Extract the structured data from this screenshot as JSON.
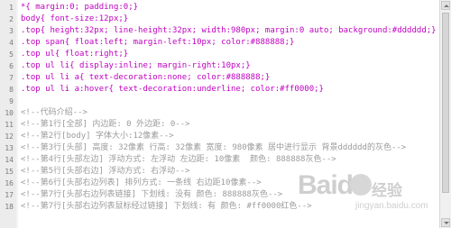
{
  "watermark": {
    "brand": "Baid",
    "brand_tail": "经验",
    "url": "jingyan.baidu.com"
  },
  "lines": [
    {
      "n": "1",
      "text": "*{ margin:0; padding:0;}",
      "type": "code"
    },
    {
      "n": "2",
      "text": "body{ font-size:12px;}",
      "type": "code"
    },
    {
      "n": "3",
      "text": ".top{ height:32px; line-height:32px; width:980px; margin:0 auto; background:#dddddd;}",
      "type": "code"
    },
    {
      "n": "4",
      "text": ".top span{ float:left; margin-left:10px; color:#888888;}",
      "type": "code"
    },
    {
      "n": "5",
      "text": ".top ul{ float:right;}",
      "type": "code"
    },
    {
      "n": "6",
      "text": ".top ul li{ display:inline; margin-right:10px;}",
      "type": "code"
    },
    {
      "n": "7",
      "text": ".top ul li a{ text-decoration:none; color:#888888;}",
      "type": "code"
    },
    {
      "n": "8",
      "text": ".top ul li a:hover{ text-decoration:underline; color:#ff0000;}",
      "type": "code"
    },
    {
      "n": "9",
      "text": "",
      "type": "blank"
    },
    {
      "n": "10",
      "text": "<!--代码介绍-->",
      "type": "comment"
    },
    {
      "n": "11",
      "text": "<!--第1行[全部] 内边距: 0 外边距: 0-->",
      "type": "comment"
    },
    {
      "n": "12",
      "text": "<!--第2行[body] 字体大小:12像素-->",
      "type": "comment"
    },
    {
      "n": "13",
      "text": "<!--第3行[头部] 高度: 32像素 行高: 32像素 宽度: 980像素 居中进行显示 背景dddddd的灰色-->",
      "type": "comment"
    },
    {
      "n": "14",
      "text": "<!--第4行[头部左边] 浮动方式: 左浮动 左边距: 10像素  颜色: 888888灰色-->",
      "type": "comment"
    },
    {
      "n": "15",
      "text": "<!--第5行[头部右边] 浮动方式: 右浮动-->",
      "type": "comment"
    },
    {
      "n": "16",
      "text": "<!--第6行[头部右边列表] 排列方式: 一条线 右边距10像素-->",
      "type": "comment"
    },
    {
      "n": "17",
      "text": "<!--第7行[头部右边列表链接] 下划线: 没有 颜色: 888888灰色-->",
      "type": "comment"
    },
    {
      "n": "18",
      "text": "<!--第7行[头部右边列表鼠标经过链接] 下划线: 有 颜色: #ff0000红色-->",
      "type": "comment"
    }
  ]
}
